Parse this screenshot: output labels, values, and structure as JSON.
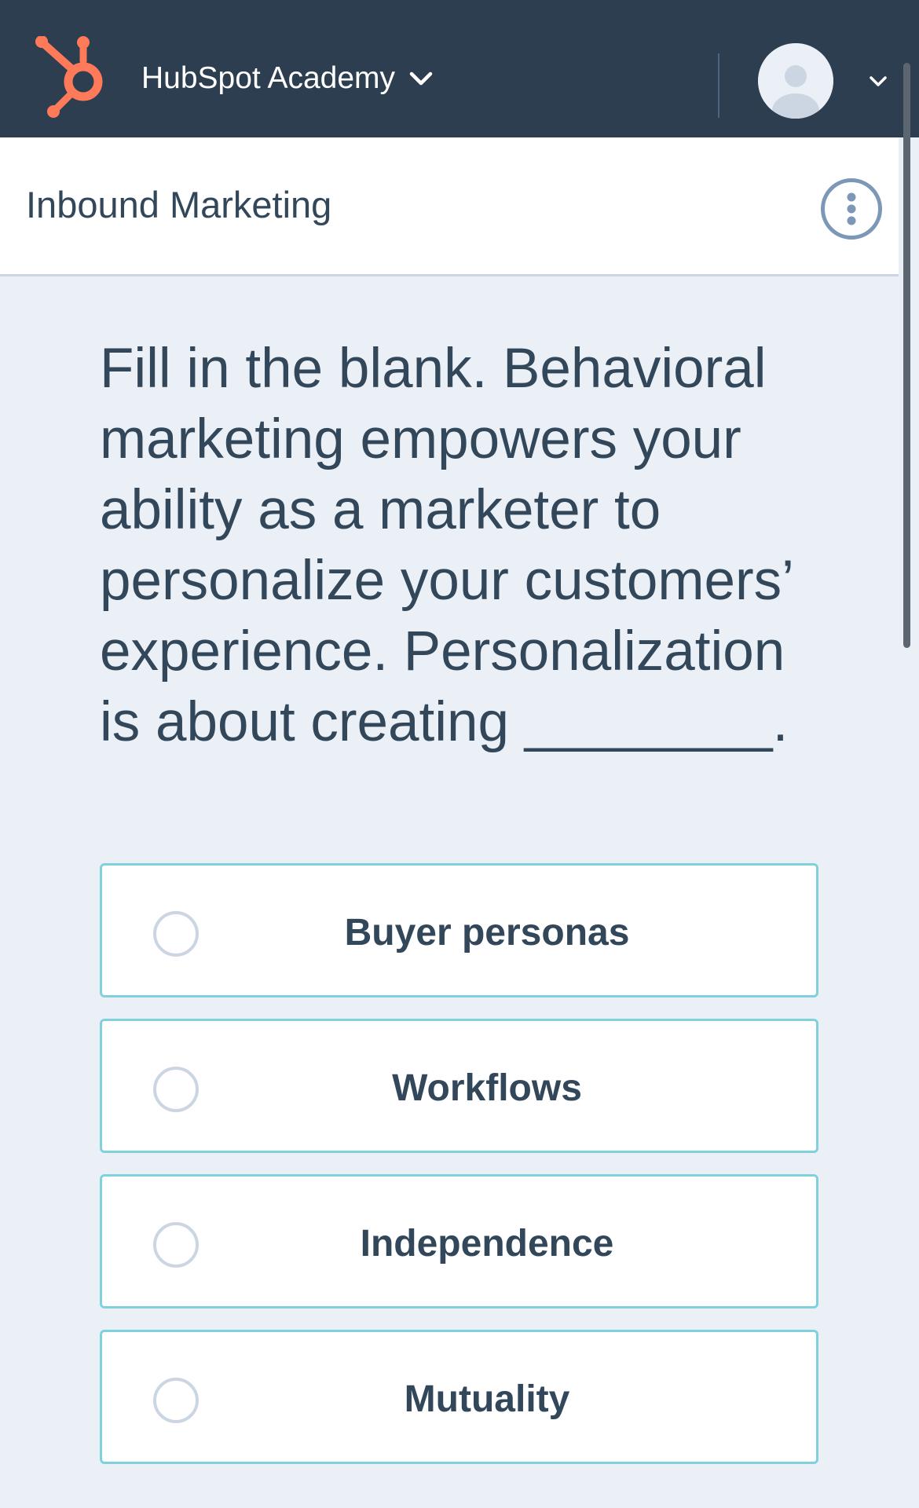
{
  "topbar": {
    "brand_label": "HubSpot Academy",
    "logo_icon": "hubspot-sprocket-icon",
    "dropdown_icon": "chevron-down-icon",
    "avatar_icon": "user-avatar-icon"
  },
  "subheader": {
    "course_title": "Inbound Marketing",
    "more_icon": "vertical-ellipsis-icon"
  },
  "question": {
    "text": "Fill in the blank. Behavioral marketing empowers your ability as a marketer to personalize your customers’ experience. Personalization is about creating ________."
  },
  "options": [
    {
      "label": "Buyer personas",
      "selected": false
    },
    {
      "label": "Workflows",
      "selected": false
    },
    {
      "label": "Independence",
      "selected": false
    },
    {
      "label": "Mutuality",
      "selected": false
    }
  ],
  "colors": {
    "topbar_bg": "#2D3E50",
    "page_bg": "#EAF0F6",
    "brand_orange": "#FF7A59",
    "text_primary": "#33475B",
    "option_border": "#7FD1DE",
    "radio_border": "#CBD6E2"
  }
}
